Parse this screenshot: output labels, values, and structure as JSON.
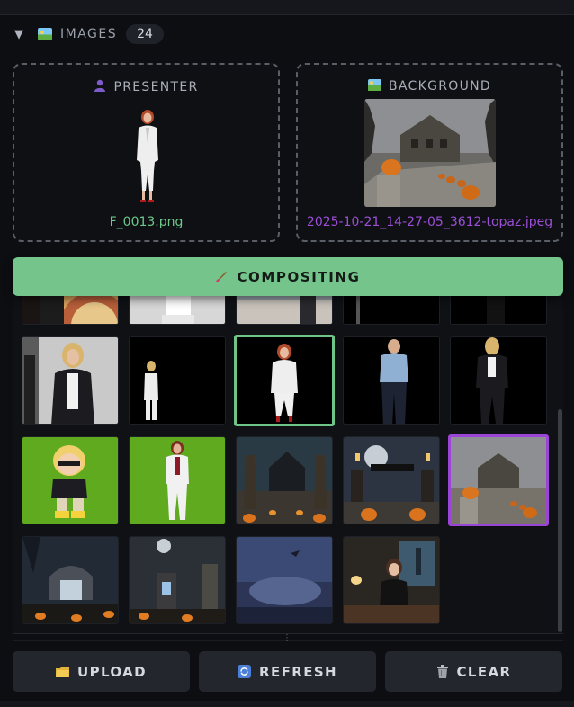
{
  "panel": {
    "title": "IMAGES",
    "count": "24",
    "collapse_icon": "caret-down-icon",
    "title_icon": "image-icon"
  },
  "presenter": {
    "label": "PRESENTER",
    "icon": "person-icon",
    "filename": "F_0013.png"
  },
  "background": {
    "label": "BACKGROUND",
    "icon": "image-icon",
    "filename": "2025-10-21_14-27-05_3612-topaz.jpeg"
  },
  "compositing": {
    "label": "COMPOSITING",
    "icon": "paintbrush-icon"
  },
  "gallery": {
    "selected_presenter_index": 7,
    "selected_background_index": 14
  },
  "actions": {
    "upload": "UPLOAD",
    "refresh": "REFRESH",
    "clear": "CLEAR"
  },
  "colors": {
    "accent_green": "#74c48b",
    "accent_purple": "#9b45d6",
    "panel_bg": "#0d0e12"
  }
}
